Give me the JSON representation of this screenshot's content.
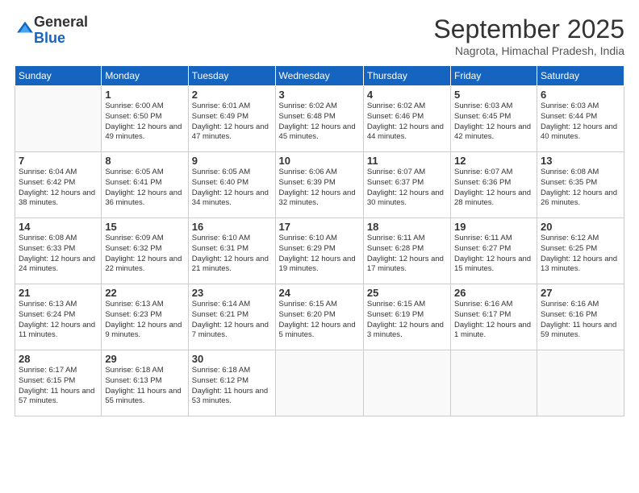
{
  "logo": {
    "general": "General",
    "blue": "Blue"
  },
  "header": {
    "month": "September 2025",
    "location": "Nagrota, Himachal Pradesh, India"
  },
  "weekdays": [
    "Sunday",
    "Monday",
    "Tuesday",
    "Wednesday",
    "Thursday",
    "Friday",
    "Saturday"
  ],
  "weeks": [
    [
      {
        "day": null
      },
      {
        "day": "1",
        "sunrise": "6:00 AM",
        "sunset": "6:50 PM",
        "daylight": "12 hours and 49 minutes."
      },
      {
        "day": "2",
        "sunrise": "6:01 AM",
        "sunset": "6:49 PM",
        "daylight": "12 hours and 47 minutes."
      },
      {
        "day": "3",
        "sunrise": "6:02 AM",
        "sunset": "6:48 PM",
        "daylight": "12 hours and 45 minutes."
      },
      {
        "day": "4",
        "sunrise": "6:02 AM",
        "sunset": "6:46 PM",
        "daylight": "12 hours and 44 minutes."
      },
      {
        "day": "5",
        "sunrise": "6:03 AM",
        "sunset": "6:45 PM",
        "daylight": "12 hours and 42 minutes."
      },
      {
        "day": "6",
        "sunrise": "6:03 AM",
        "sunset": "6:44 PM",
        "daylight": "12 hours and 40 minutes."
      }
    ],
    [
      {
        "day": "7",
        "sunrise": "6:04 AM",
        "sunset": "6:42 PM",
        "daylight": "12 hours and 38 minutes."
      },
      {
        "day": "8",
        "sunrise": "6:05 AM",
        "sunset": "6:41 PM",
        "daylight": "12 hours and 36 minutes."
      },
      {
        "day": "9",
        "sunrise": "6:05 AM",
        "sunset": "6:40 PM",
        "daylight": "12 hours and 34 minutes."
      },
      {
        "day": "10",
        "sunrise": "6:06 AM",
        "sunset": "6:39 PM",
        "daylight": "12 hours and 32 minutes."
      },
      {
        "day": "11",
        "sunrise": "6:07 AM",
        "sunset": "6:37 PM",
        "daylight": "12 hours and 30 minutes."
      },
      {
        "day": "12",
        "sunrise": "6:07 AM",
        "sunset": "6:36 PM",
        "daylight": "12 hours and 28 minutes."
      },
      {
        "day": "13",
        "sunrise": "6:08 AM",
        "sunset": "6:35 PM",
        "daylight": "12 hours and 26 minutes."
      }
    ],
    [
      {
        "day": "14",
        "sunrise": "6:08 AM",
        "sunset": "6:33 PM",
        "daylight": "12 hours and 24 minutes."
      },
      {
        "day": "15",
        "sunrise": "6:09 AM",
        "sunset": "6:32 PM",
        "daylight": "12 hours and 22 minutes."
      },
      {
        "day": "16",
        "sunrise": "6:10 AM",
        "sunset": "6:31 PM",
        "daylight": "12 hours and 21 minutes."
      },
      {
        "day": "17",
        "sunrise": "6:10 AM",
        "sunset": "6:29 PM",
        "daylight": "12 hours and 19 minutes."
      },
      {
        "day": "18",
        "sunrise": "6:11 AM",
        "sunset": "6:28 PM",
        "daylight": "12 hours and 17 minutes."
      },
      {
        "day": "19",
        "sunrise": "6:11 AM",
        "sunset": "6:27 PM",
        "daylight": "12 hours and 15 minutes."
      },
      {
        "day": "20",
        "sunrise": "6:12 AM",
        "sunset": "6:25 PM",
        "daylight": "12 hours and 13 minutes."
      }
    ],
    [
      {
        "day": "21",
        "sunrise": "6:13 AM",
        "sunset": "6:24 PM",
        "daylight": "12 hours and 11 minutes."
      },
      {
        "day": "22",
        "sunrise": "6:13 AM",
        "sunset": "6:23 PM",
        "daylight": "12 hours and 9 minutes."
      },
      {
        "day": "23",
        "sunrise": "6:14 AM",
        "sunset": "6:21 PM",
        "daylight": "12 hours and 7 minutes."
      },
      {
        "day": "24",
        "sunrise": "6:15 AM",
        "sunset": "6:20 PM",
        "daylight": "12 hours and 5 minutes."
      },
      {
        "day": "25",
        "sunrise": "6:15 AM",
        "sunset": "6:19 PM",
        "daylight": "12 hours and 3 minutes."
      },
      {
        "day": "26",
        "sunrise": "6:16 AM",
        "sunset": "6:17 PM",
        "daylight": "12 hours and 1 minute."
      },
      {
        "day": "27",
        "sunrise": "6:16 AM",
        "sunset": "6:16 PM",
        "daylight": "11 hours and 59 minutes."
      }
    ],
    [
      {
        "day": "28",
        "sunrise": "6:17 AM",
        "sunset": "6:15 PM",
        "daylight": "11 hours and 57 minutes."
      },
      {
        "day": "29",
        "sunrise": "6:18 AM",
        "sunset": "6:13 PM",
        "daylight": "11 hours and 55 minutes."
      },
      {
        "day": "30",
        "sunrise": "6:18 AM",
        "sunset": "6:12 PM",
        "daylight": "11 hours and 53 minutes."
      },
      {
        "day": null
      },
      {
        "day": null
      },
      {
        "day": null
      },
      {
        "day": null
      }
    ]
  ]
}
